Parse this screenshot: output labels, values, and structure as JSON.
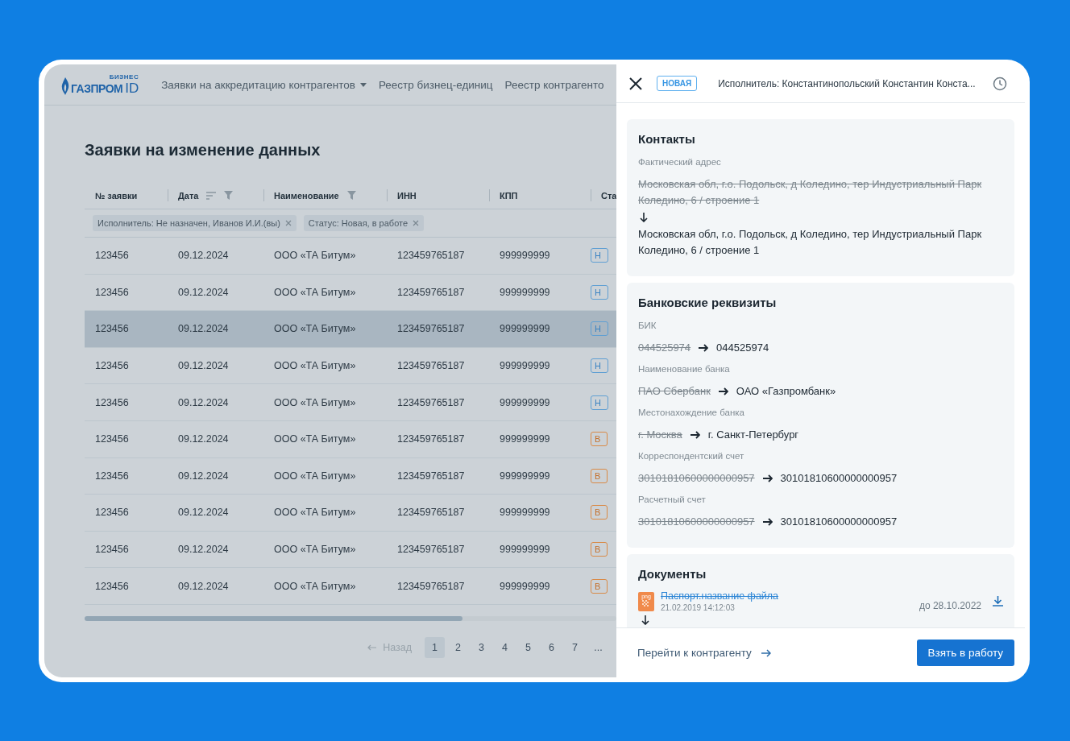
{
  "header": {
    "logo": {
      "small": "БИЗНЕС",
      "name": "ГАЗПРОМ",
      "suffix": "ID"
    },
    "nav": [
      {
        "label": "Заявки на аккредитацию контрагентов",
        "dropdown": true
      },
      {
        "label": "Реестр бизнец-единиц",
        "dropdown": false
      },
      {
        "label": "Реестр контрагенто",
        "dropdown": false
      }
    ]
  },
  "page_title": "Заявки на изменение данных",
  "table": {
    "columns": [
      {
        "label": "№ заявки",
        "sortable": false,
        "filterable": false
      },
      {
        "label": "Дата",
        "sortable": true,
        "filterable": true
      },
      {
        "label": "Наименование",
        "sortable": false,
        "filterable": true
      },
      {
        "label": "ИНН",
        "sortable": false,
        "filterable": false
      },
      {
        "label": "КПП",
        "sortable": false,
        "filterable": false
      },
      {
        "label": "Ста"
      }
    ],
    "filters": [
      {
        "label": "Исполнитель: Не назначен, Иванов И.И.(вы)"
      },
      {
        "label": "Статус: Новая, в работе"
      }
    ],
    "rows": [
      {
        "cells": [
          "123456",
          "09.12.2024",
          "ООО «ТА Битум»",
          "123459765187",
          "999999999"
        ],
        "status": {
          "label": "Н",
          "kind": "new"
        },
        "selected": false
      },
      {
        "cells": [
          "123456",
          "09.12.2024",
          "ООО «ТА Битум»",
          "123459765187",
          "999999999"
        ],
        "status": {
          "label": "Н",
          "kind": "new"
        },
        "selected": false
      },
      {
        "cells": [
          "123456",
          "09.12.2024",
          "ООО «ТА Битум»",
          "123459765187",
          "999999999"
        ],
        "status": {
          "label": "Н",
          "kind": "new"
        },
        "selected": true
      },
      {
        "cells": [
          "123456",
          "09.12.2024",
          "ООО «ТА Битум»",
          "123459765187",
          "999999999"
        ],
        "status": {
          "label": "Н",
          "kind": "new"
        },
        "selected": false
      },
      {
        "cells": [
          "123456",
          "09.12.2024",
          "ООО «ТА Битум»",
          "123459765187",
          "999999999"
        ],
        "status": {
          "label": "Н",
          "kind": "new"
        },
        "selected": false
      },
      {
        "cells": [
          "123456",
          "09.12.2024",
          "ООО «ТА Битум»",
          "123459765187",
          "999999999"
        ],
        "status": {
          "label": "В",
          "kind": "in_progress"
        },
        "selected": false
      },
      {
        "cells": [
          "123456",
          "09.12.2024",
          "ООО «ТА Битум»",
          "123459765187",
          "999999999"
        ],
        "status": {
          "label": "В",
          "kind": "in_progress"
        },
        "selected": false
      },
      {
        "cells": [
          "123456",
          "09.12.2024",
          "ООО «ТА Битум»",
          "123459765187",
          "999999999"
        ],
        "status": {
          "label": "В",
          "kind": "in_progress"
        },
        "selected": false
      },
      {
        "cells": [
          "123456",
          "09.12.2024",
          "ООО «ТА Битум»",
          "123459765187",
          "999999999"
        ],
        "status": {
          "label": "В",
          "kind": "in_progress"
        },
        "selected": false
      },
      {
        "cells": [
          "123456",
          "09.12.2024",
          "ООО «ТА Битум»",
          "123459765187",
          "999999999"
        ],
        "status": {
          "label": "В",
          "kind": "in_progress"
        },
        "selected": false
      }
    ]
  },
  "pagination": {
    "prev": "Назад",
    "pages": [
      {
        "label": "1",
        "selected": true
      },
      {
        "label": "2",
        "selected": false
      },
      {
        "label": "3",
        "selected": false
      },
      {
        "label": "4",
        "selected": false
      },
      {
        "label": "5",
        "selected": false
      },
      {
        "label": "6",
        "selected": false
      },
      {
        "label": "7",
        "selected": false
      }
    ],
    "more": "..."
  },
  "panel": {
    "status": "НОВАЯ",
    "executor": "Исполнитель: Константинопольский Константин Конста...",
    "sections": [
      {
        "title": "Контакты",
        "fields": [
          {
            "kind": "stacked",
            "label": "Фактический адрес",
            "old": "Московская обл, г.о. Подольск, д Коледино, тер Индустриальный Парк Коледино, 6 / строение 1",
            "new": "Московская обл, г.о. Подольск, д Коледино, тер Индустриальный Парк Коледино, 6 / строение 1"
          }
        ]
      },
      {
        "title": "Банковские реквизиты",
        "fields": [
          {
            "kind": "inline",
            "label": "БИК",
            "old": "044525974",
            "new": "044525974"
          },
          {
            "kind": "inline",
            "label": "Наименование банка",
            "old": "ПАО Сбербанк",
            "new": "ОАО «Газпромбанк»"
          },
          {
            "kind": "inline",
            "label": "Местонахождение банка",
            "old": "г. Москва",
            "new": "г. Санкт-Петербург"
          },
          {
            "kind": "inline",
            "label": "Корреспондентский счет",
            "old": "30101810600000000957",
            "new": "30101810600000000957"
          },
          {
            "kind": "inline",
            "label": "Расчетный счет",
            "old": "30101810600000000957",
            "new": "30101810600000000957"
          }
        ]
      }
    ],
    "documents": {
      "title": "Документы",
      "items": [
        {
          "name": "Паспорт.название файла",
          "type": "png",
          "date": "21.02.2019 14:12:03",
          "valid_until": "до 28.10.2022",
          "removed": true
        }
      ]
    },
    "footer": {
      "link": "Перейти к контрагенту",
      "button": "Взять в работу"
    }
  }
}
